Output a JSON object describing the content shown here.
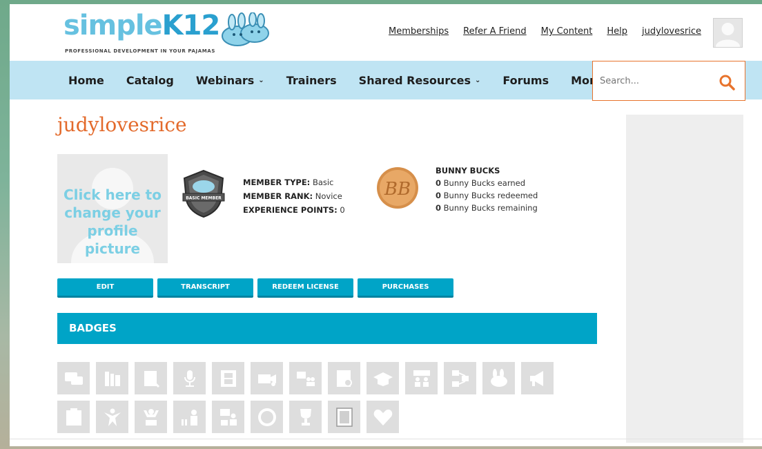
{
  "logo": {
    "name_part1": "simple",
    "name_part2": "K12",
    "tagline": "PROFESSIONAL DEVELOPMENT IN YOUR PAJAMAS"
  },
  "top_links": [
    "Memberships",
    "Refer A Friend",
    "My Content",
    "Help",
    "judylovesrice"
  ],
  "nav": {
    "items": [
      {
        "label": "Home",
        "dropdown": false
      },
      {
        "label": "Catalog",
        "dropdown": false
      },
      {
        "label": "Webinars",
        "dropdown": true
      },
      {
        "label": "Trainers",
        "dropdown": false
      },
      {
        "label": "Shared Resources",
        "dropdown": true
      },
      {
        "label": "Forums",
        "dropdown": false
      },
      {
        "label": "More",
        "dropdown": true
      }
    ],
    "search_placeholder": "Search..."
  },
  "profile": {
    "username": "judylovesrice",
    "picture_prompt": [
      "Click here to",
      "change your",
      "profile picture"
    ],
    "shield_text": "BASIC MEMBER",
    "member_type_label": "MEMBER TYPE:",
    "member_type": "Basic",
    "member_rank_label": "MEMBER RANK:",
    "member_rank": "Novice",
    "experience_label": "EXPERIENCE POINTS:",
    "experience_points": "0",
    "coin_text": "BB"
  },
  "bunny_bucks": {
    "title": "BUNNY BUCKS",
    "earned_count": "0",
    "earned_label": "Bunny Bucks earned",
    "redeemed_count": "0",
    "redeemed_label": "Bunny Bucks redeemed",
    "remaining_count": "0",
    "remaining_label": "Bunny Bucks remaining"
  },
  "buttons": [
    "EDIT",
    "TRANSCRIPT",
    "REDEEM LICENSE",
    "PURCHASES"
  ],
  "badges": {
    "title": "BADGES",
    "row1": [
      "speech-bubbles-icon",
      "books-icon",
      "notepad-icon",
      "microphone-icon",
      "film-icon",
      "camera-icon",
      "people-icon",
      "certificate-icon",
      "graduation-cap-icon",
      "team-icon",
      "flowchart-icon",
      "bunny-icon",
      "megaphone-icon"
    ],
    "row2": [
      "clipboard-icon",
      "star-person-icon",
      "trophy-person-icon",
      "audience-icon",
      "presenter-icon",
      "coin-icon",
      "trophy-icon",
      "framed-picture-icon",
      "heart-icon"
    ]
  },
  "colors": {
    "accent": "#00a4c7",
    "username": "#e36a2b",
    "nav_bg": "#bfe4f3",
    "search_border": "#e8732c"
  }
}
